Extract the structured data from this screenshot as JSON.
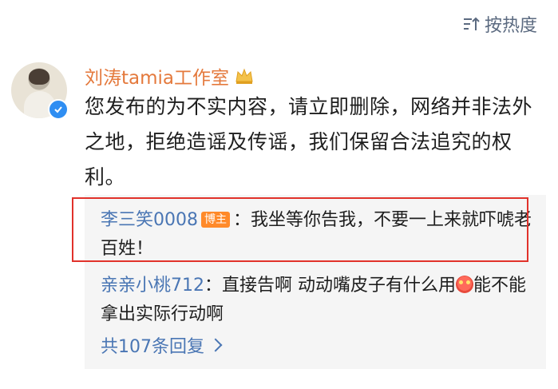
{
  "sort": {
    "label": "按热度",
    "icon": "sort-icon"
  },
  "post": {
    "author": "刘涛tamia工作室",
    "author_color": "#e4793c",
    "text": "您发布的为不实内容，请立即删除，网络并非法外之地，拒绝造谣及传谣，我们保留合法追究的权利。"
  },
  "replies": [
    {
      "user": "李三笑0008",
      "badge": "博主",
      "text": "：我坐等你告我，不要一上来就吓唬老百姓！"
    },
    {
      "user": "亲亲小桃712",
      "text_before_emoji": "：直接告啊 动动嘴皮子有什么用",
      "emoji": "angry-face-icon",
      "text_after_emoji": "能不能拿出实际行动啊"
    }
  ],
  "more_replies": "共107条回复",
  "colors": {
    "link_blue": "#4a76b4",
    "highlight_red": "#e1322b",
    "badge_orange": "#ff8a2a",
    "verified_blue": "#2f8ef2"
  }
}
